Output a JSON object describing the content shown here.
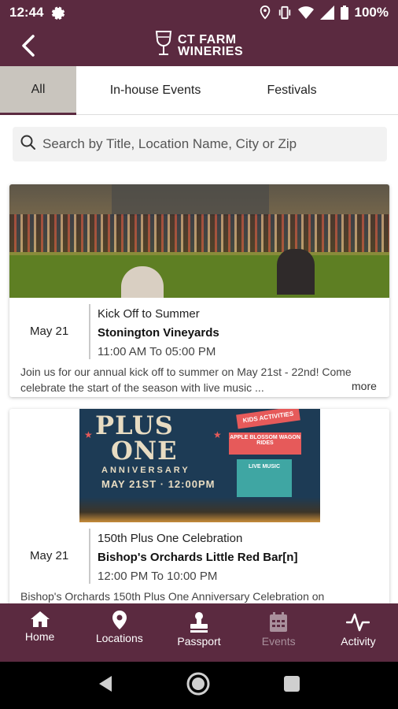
{
  "status": {
    "time": "12:44",
    "battery": "100%"
  },
  "header": {
    "logo_line1": "CT FARM",
    "logo_line2": "WINERIES"
  },
  "tabs": [
    {
      "label": "All",
      "active": true
    },
    {
      "label": "In-house Events",
      "active": false
    },
    {
      "label": "Festivals",
      "active": false
    }
  ],
  "search": {
    "placeholder": "Search by Title, Location Name, City or Zip",
    "value": ""
  },
  "events": [
    {
      "date": "May 21",
      "title": "Kick Off to Summer",
      "venue": "Stonington Vineyards",
      "time": "11:00 AM To 05:00 PM",
      "description": "Join us for our annual kick off to summer on May 21st - 22nd! Come celebrate the start of the season with live music ...",
      "more": "more"
    },
    {
      "date": "May 21",
      "title": "150th Plus One Celebration",
      "venue": "Bishop's Orchards Little Red Bar[n]",
      "time": "12:00 PM To 10:00 PM",
      "description": "Bishop's Orchards 150th Plus One Anniversary Celebration on",
      "poster": {
        "line1": "PLUS",
        "line2": "ONE",
        "line3": "ANNIVERSARY",
        "line4": "MAY 21ST · 12:00PM",
        "sign1": "KIDS ACTIVITIES",
        "sign2": "APPLE BLOSSOM WAGON RIDES",
        "sign3": "LIVE MUSIC"
      }
    }
  ],
  "bottom_nav": [
    {
      "label": "Home",
      "icon": "home-icon",
      "active": true
    },
    {
      "label": "Locations",
      "icon": "location-pin-icon",
      "active": true
    },
    {
      "label": "Passport",
      "icon": "stamp-icon",
      "active": true
    },
    {
      "label": "Events",
      "icon": "calendar-icon",
      "active": false
    },
    {
      "label": "Activity",
      "icon": "activity-icon",
      "active": true
    }
  ],
  "colors": {
    "brand": "#5b2a40",
    "active_tab": "#c9c5be"
  }
}
